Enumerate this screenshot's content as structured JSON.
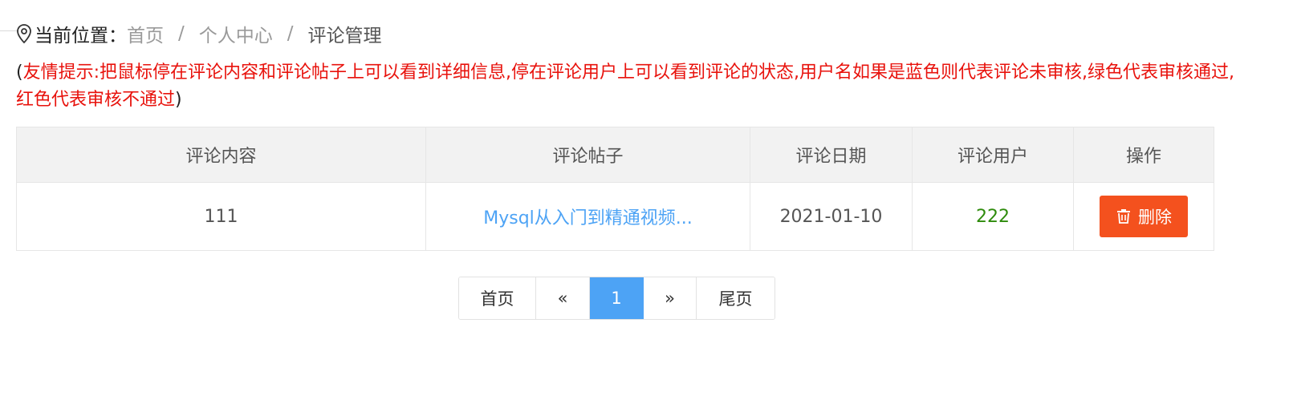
{
  "breadcrumb": {
    "label": "当前位置：",
    "items": [
      "首页",
      "个人中心",
      "评论管理"
    ],
    "separator": "/"
  },
  "tip": {
    "open": "(",
    "text": "友情提示:把鼠标停在评论内容和评论帖子上可以看到详细信息,停在评论用户上可以看到评论的状态,用户名如果是蓝色则代表评论未审核,绿色代表审核通过,红色代表审核不通过",
    "close": ")"
  },
  "table": {
    "headers": [
      "评论内容",
      "评论帖子",
      "评论日期",
      "评论用户",
      "操作"
    ],
    "rows": [
      {
        "content": "111",
        "post": "Mysql从入门到精通视频...",
        "date": "2021-01-10",
        "user": "222",
        "action": "删除"
      }
    ]
  },
  "pagination": {
    "first": "首页",
    "prev": "«",
    "current": "1",
    "next": "»",
    "last": "尾页"
  },
  "colors": {
    "tip_red": "#e8120c",
    "link_blue": "#4da3f5",
    "user_green": "#2e8b0c",
    "delete_orange": "#f4511e"
  },
  "icons": {
    "location": "location-pin-icon",
    "delete": "trash-icon"
  }
}
